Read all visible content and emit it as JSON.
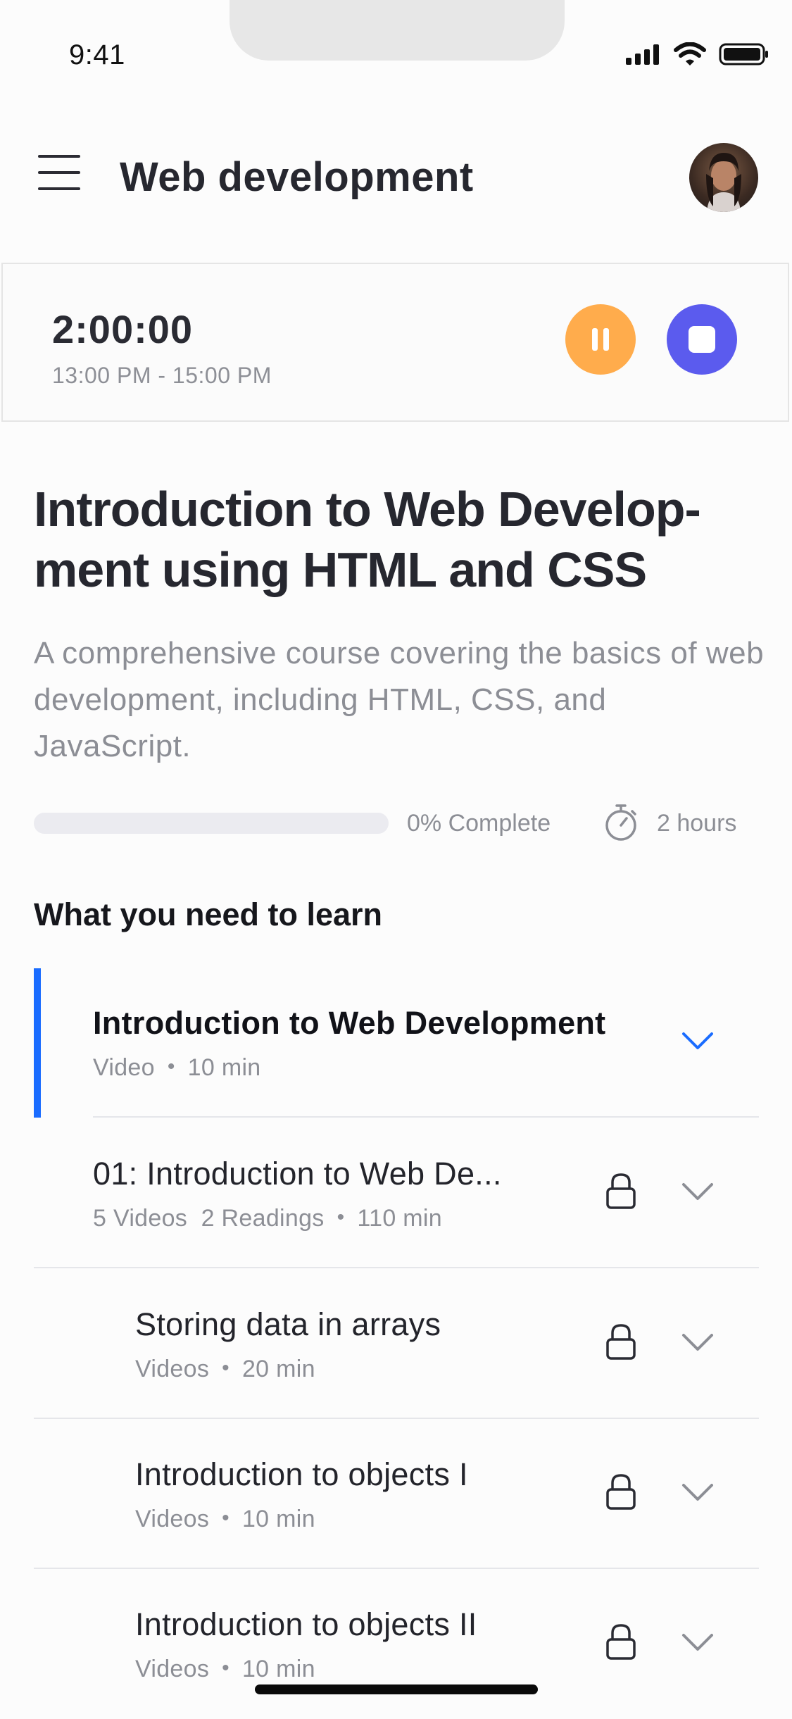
{
  "status_bar": {
    "time": "9:41"
  },
  "header": {
    "title": "Web development",
    "menu_icon": "hamburger-menu-icon",
    "avatar_alt": "profile-avatar"
  },
  "timer": {
    "value": "2:00:00",
    "range": "13:00 PM - 15:00 PM",
    "pause_color": "#ffac4c",
    "stop_color": "#5b5bee"
  },
  "course": {
    "title": "Introduction to Web Develop-ment using HTML and CSS",
    "description": "A comprehensive course covering the basics of web development, including HTML, CSS, and JavaScript.",
    "progress_percent": 0,
    "progress_label": "0% Complete",
    "duration_label": "2 hours"
  },
  "section": {
    "heading": "What you need to learn"
  },
  "lessons": [
    {
      "title": "Introduction to Web Development",
      "meta": [
        "Video",
        "10 min"
      ],
      "active": true,
      "locked": false
    },
    {
      "title": "01: Introduction to Web De...",
      "meta": [
        "5 Videos  2 Readings",
        "110 min"
      ],
      "active": false,
      "locked": true
    },
    {
      "title": "Storing data in arrays",
      "meta": [
        "Videos",
        "20 min"
      ],
      "active": false,
      "locked": true
    },
    {
      "title": "Introduction to objects I",
      "meta": [
        "Videos",
        "10 min"
      ],
      "active": false,
      "locked": true
    },
    {
      "title": "Introduction to objects II",
      "meta": [
        "Videos",
        "10 min"
      ],
      "active": false,
      "locked": true
    }
  ],
  "colors": {
    "accent": "#1a6cff",
    "text_primary": "#24252b",
    "text_secondary": "#8c8e95"
  }
}
